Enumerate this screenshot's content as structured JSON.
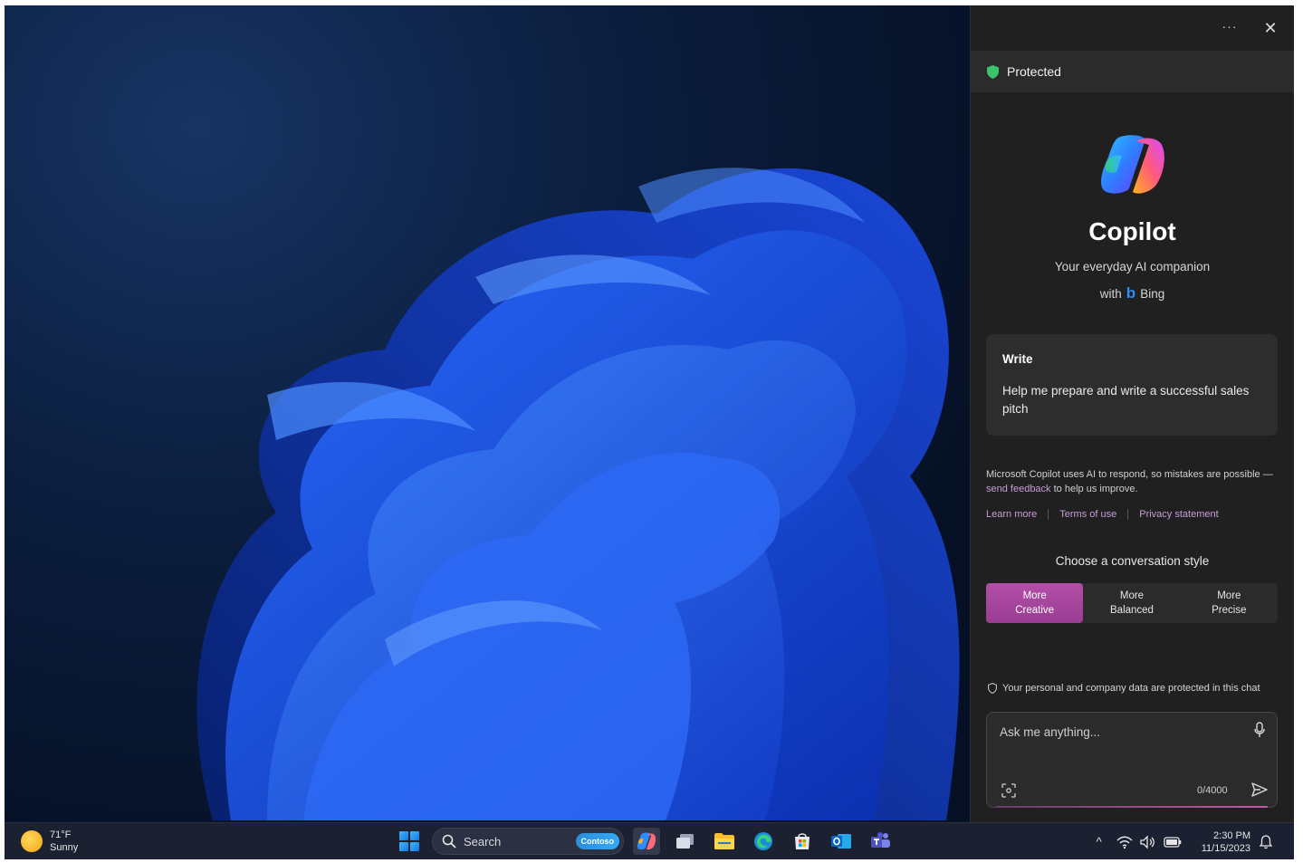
{
  "panel": {
    "more_label": "···",
    "close_label": "✕",
    "protected_label": "Protected",
    "title": "Copilot",
    "subtitle": "Your everyday AI companion",
    "with_label": "with",
    "bing_logo_glyph": "b",
    "bing_label": "Bing",
    "suggestion": {
      "title": "Write",
      "body": "Help me prepare and write a successful sales pitch"
    },
    "disclaimer_text": "Microsoft Copilot uses AI to respond, so mistakes are possible — ",
    "feedback_link": "send feedback",
    "disclaimer_tail": " to help us improve.",
    "links": [
      "Learn more",
      "Terms of use",
      "Privacy statement"
    ],
    "style_title": "Choose a conversation style",
    "styles": [
      {
        "line1": "More",
        "line2": "Creative",
        "active": true
      },
      {
        "line1": "More",
        "line2": "Balanced",
        "active": false
      },
      {
        "line1": "More",
        "line2": "Precise",
        "active": false
      }
    ],
    "data_protected_text": "Your personal and company data are protected in this chat",
    "input_placeholder": "Ask me anything...",
    "char_count": "0/4000"
  },
  "taskbar": {
    "weather_temp": "71°F",
    "weather_cond": "Sunny",
    "search_placeholder": "Search",
    "search_chip": "Contoso",
    "time": "2:30 PM",
    "date": "11/15/2023",
    "tray_chevron": "^"
  },
  "colors": {
    "accent_creative": "#b24ea8",
    "panel_bg": "#202020",
    "protected_green": "#3cc36b",
    "link": "#c99bd9"
  }
}
